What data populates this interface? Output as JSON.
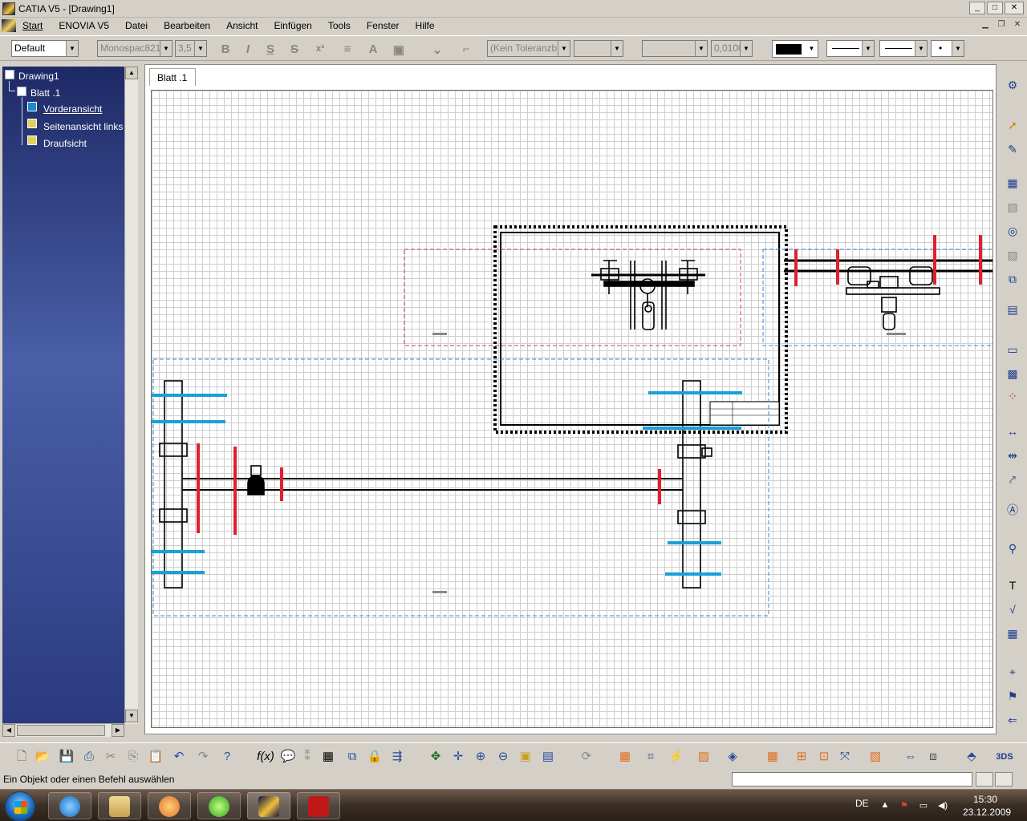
{
  "window": {
    "title": "CATIA V5 - [Drawing1]",
    "minimize": "_",
    "maximize": "□",
    "close": "✕"
  },
  "menu": {
    "items": [
      "Start",
      "ENOVIA V5",
      "Datei",
      "Bearbeiten",
      "Ansicht",
      "Einfügen",
      "Tools",
      "Fenster",
      "Hilfe"
    ]
  },
  "format_toolbar": {
    "style": "Default",
    "font": "Monospac821",
    "font_size": "3,5",
    "bold": "B",
    "italic": "I",
    "underline": "S",
    "strikethrough": "S",
    "tolerance": "(Kein Toleranzb",
    "precision": "0,0100",
    "line_color": "#000000"
  },
  "tree": {
    "root": "Drawing1",
    "sheet": "Blatt .1",
    "views": [
      "Vorderansicht",
      "Seitenansicht links",
      "Draufsicht"
    ]
  },
  "sheet_tab": {
    "label": "Blatt .1"
  },
  "drawing_colors": {
    "red_lines": "#e02030",
    "blue_lines": "#1aa0d8",
    "frame_red": "#d04050",
    "frame_blue": "#3a8ad0"
  },
  "status": {
    "message": "Ein Objekt oder einen Befehl auswählen"
  },
  "taskbar": {
    "language": "DE",
    "time": "15:30",
    "date": "23.12.2009",
    "apps": [
      "internet-explorer",
      "file-explorer",
      "media-player",
      "icq",
      "catia",
      "adobe-reader"
    ]
  }
}
